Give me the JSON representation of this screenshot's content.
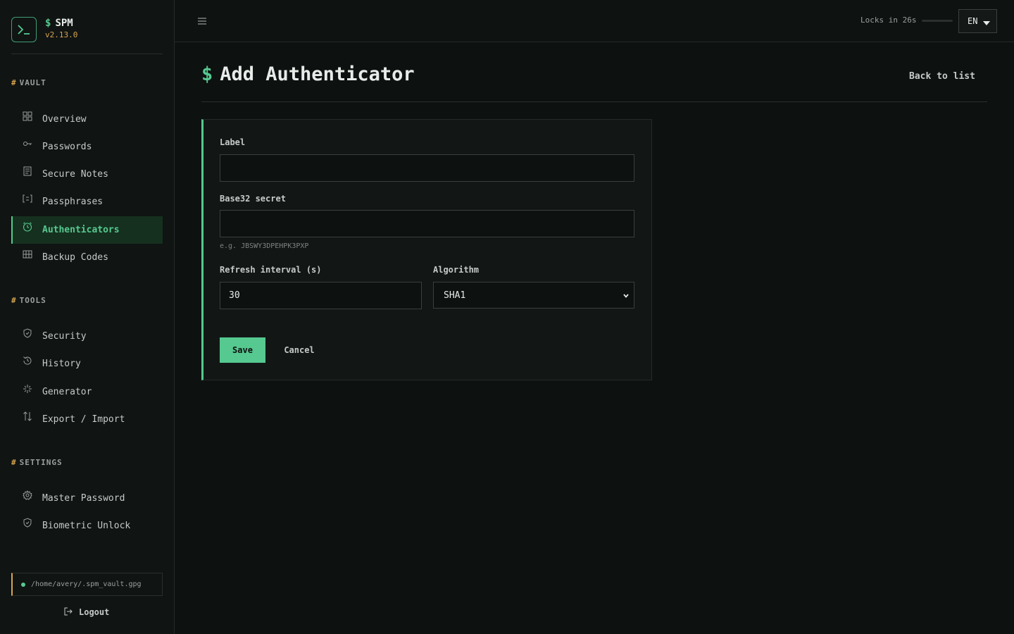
{
  "brand": {
    "prompt": "$",
    "name": "SPM",
    "version": "v2.13.0",
    "logo_icon": "terminal-prompt-icon"
  },
  "sidebar": {
    "sections": [
      {
        "prefix": "#",
        "title": "VAULT",
        "items": [
          {
            "label": "Overview",
            "icon": "grid-icon",
            "active": false
          },
          {
            "label": "Passwords",
            "icon": "key-icon",
            "active": false
          },
          {
            "label": "Secure Notes",
            "icon": "note-icon",
            "active": false
          },
          {
            "label": "Passphrases",
            "icon": "bracket-icon",
            "active": false
          },
          {
            "label": "Authenticators",
            "icon": "clock-icon",
            "active": true
          },
          {
            "label": "Backup Codes",
            "icon": "table-icon",
            "active": false
          }
        ]
      },
      {
        "prefix": "#",
        "title": "TOOLS",
        "items": [
          {
            "label": "Security",
            "icon": "shield-icon",
            "active": false
          },
          {
            "label": "History",
            "icon": "history-icon",
            "active": false
          },
          {
            "label": "Generator",
            "icon": "sparkle-icon",
            "active": false
          },
          {
            "label": "Export / Import",
            "icon": "arrows-updown-icon",
            "active": false
          }
        ]
      },
      {
        "prefix": "#",
        "title": "SETTINGS",
        "items": [
          {
            "label": "Master Password",
            "icon": "gear-icon",
            "active": false
          },
          {
            "label": "Biometric Unlock",
            "icon": "shield-icon",
            "active": false
          }
        ]
      }
    ],
    "vault_path": "/home/avery/.spm_vault.gpg",
    "logout_label": "Logout"
  },
  "topbar": {
    "locks_text": "Locks in 26s",
    "lock_progress": 0.0,
    "language": "EN"
  },
  "page": {
    "prompt": "$",
    "title": "Add Authenticator",
    "back_label": "Back to list"
  },
  "form": {
    "label_field": {
      "label": "Label",
      "value": "",
      "placeholder": ""
    },
    "secret_field": {
      "label": "Base32 secret",
      "value": "",
      "placeholder": "",
      "hint": "e.g. JBSWY3DPEHPK3PXP"
    },
    "interval_field": {
      "label": "Refresh interval (s)",
      "value": "30"
    },
    "algorithm_field": {
      "label": "Algorithm",
      "value": "SHA1"
    },
    "save_label": "Save",
    "cancel_label": "Cancel"
  },
  "colors": {
    "accent": "#56c990",
    "warning": "#d8a550",
    "background": "#0d1110",
    "active_bg": "#15301f"
  }
}
